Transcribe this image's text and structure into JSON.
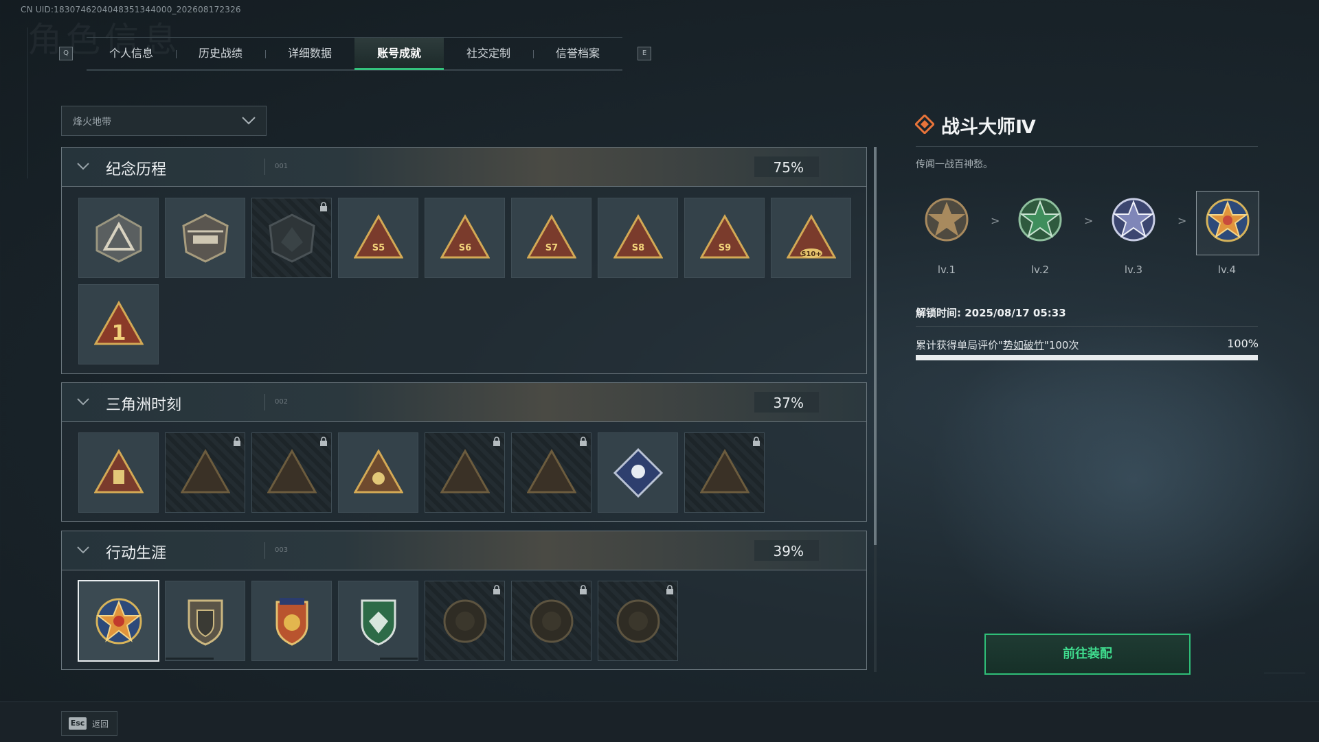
{
  "uid_text": "CN UID:1830746204048351344000_202608172326",
  "tabs": {
    "left_key": "Q",
    "right_key": "E",
    "items": [
      {
        "label": "个人信息",
        "active": false
      },
      {
        "label": "历史战绩",
        "active": false
      },
      {
        "label": "详细数据",
        "active": false
      },
      {
        "label": "账号成就",
        "active": true
      },
      {
        "label": "社交定制",
        "active": false
      },
      {
        "label": "信誉档案",
        "active": false
      }
    ]
  },
  "mode_dropdown": {
    "value": "烽火地带"
  },
  "sections": [
    {
      "title": "纪念历程",
      "num": "001",
      "percent": "75%",
      "medals": [
        {
          "label": "",
          "locked": false,
          "icon": "triangle-emblem-icon"
        },
        {
          "label": "",
          "locked": false,
          "icon": "helicopter-badge-icon"
        },
        {
          "label": "",
          "locked": true,
          "icon": "dark-shield-icon"
        },
        {
          "label": "S5",
          "locked": false,
          "icon": "season-badge-icon"
        },
        {
          "label": "S6",
          "locked": false,
          "icon": "season-badge-icon"
        },
        {
          "label": "S7",
          "locked": false,
          "icon": "season-badge-icon"
        },
        {
          "label": "S8",
          "locked": false,
          "icon": "season-badge-icon"
        },
        {
          "label": "S9",
          "locked": false,
          "icon": "season-badge-icon"
        },
        {
          "label": "S10+",
          "locked": false,
          "icon": "season-badge-icon"
        },
        {
          "label": "1",
          "locked": false,
          "icon": "rank-one-badge-icon"
        }
      ]
    },
    {
      "title": "三角洲时刻",
      "num": "002",
      "percent": "37%",
      "medals": [
        {
          "label": "",
          "locked": false,
          "icon": "triangle-emblem-icon"
        },
        {
          "label": "",
          "locked": true,
          "icon": "triangle-emblem-icon"
        },
        {
          "label": "",
          "locked": true,
          "icon": "triangle-emblem-icon"
        },
        {
          "label": "",
          "locked": false,
          "icon": "triangle-emblem-icon"
        },
        {
          "label": "",
          "locked": true,
          "icon": "triangle-emblem-icon"
        },
        {
          "label": "",
          "locked": true,
          "icon": "triangle-emblem-icon"
        },
        {
          "label": "",
          "locked": false,
          "icon": "diamond-rose-icon"
        },
        {
          "label": "",
          "locked": true,
          "icon": "triangle-emblem-icon"
        }
      ]
    },
    {
      "title": "行动生涯",
      "num": "003",
      "percent": "39%",
      "medals": [
        {
          "label": "",
          "locked": false,
          "icon": "star-medal-icon",
          "selected": true
        },
        {
          "label": "",
          "locked": false,
          "icon": "shield-badge-icon"
        },
        {
          "label": "",
          "locked": false,
          "icon": "winged-shield-icon"
        },
        {
          "label": "",
          "locked": false,
          "icon": "green-shield-icon"
        },
        {
          "label": "",
          "locked": true,
          "icon": "round-emblem-icon"
        },
        {
          "label": "",
          "locked": true,
          "icon": "round-emblem-icon"
        },
        {
          "label": "",
          "locked": true,
          "icon": "round-emblem-icon"
        }
      ]
    }
  ],
  "detail": {
    "title": "战斗大师Ⅳ",
    "description": "传闻一战百神愁。",
    "levels": [
      {
        "label": "lv.1",
        "color": "#a88a5e"
      },
      {
        "label": "lv.2",
        "color": "#3f8e5c"
      },
      {
        "label": "lv.3",
        "color": "#7f86b8"
      },
      {
        "label": "lv.4",
        "color": "#c94b3c"
      }
    ],
    "arrow": ">",
    "unlock_time": "解锁时间: 2025/08/17 05:33",
    "requirement_prefix": "累计获得单局评价\"",
    "requirement_link": "势如破竹",
    "requirement_suffix": "\"100次",
    "requirement_percent": "100%",
    "requirement_progress": 1.0,
    "equip_button": "前往装配"
  },
  "footer": {
    "esc_key": "Esc",
    "back_label": "返回"
  }
}
